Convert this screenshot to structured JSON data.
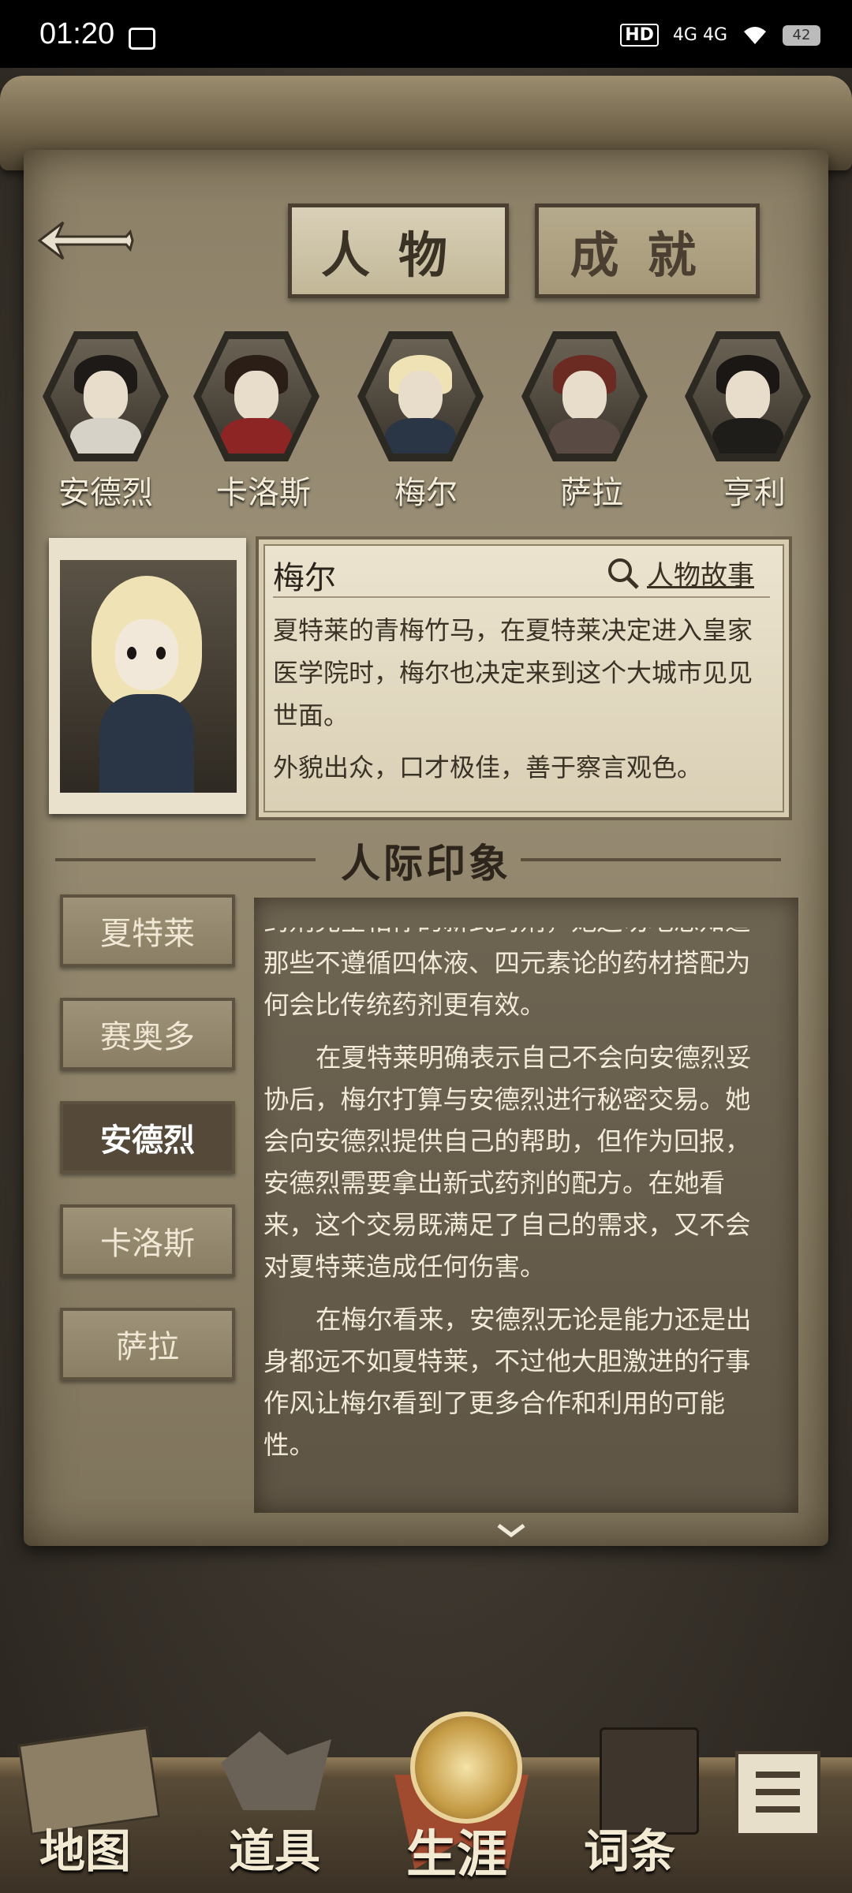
{
  "status_bar": {
    "time": "01:20",
    "network": "4G 4G",
    "hd": "HD",
    "battery": "42"
  },
  "tabs": {
    "characters": "人物",
    "achievements": "成就"
  },
  "characters": [
    {
      "name": "安德烈"
    },
    {
      "name": "卡洛斯"
    },
    {
      "name": "梅尔"
    },
    {
      "name": "萨拉"
    },
    {
      "name": "亨利"
    }
  ],
  "selected": {
    "name": "梅尔",
    "story_link": "人物故事",
    "description": "夏特莱的青梅竹马，在夏特莱决定进入皇家医学院时，梅尔也决定来到这个大城市见见世面。",
    "trait": "外貌出众，口才极佳，善于察言观色。"
  },
  "section_title": "人际印象",
  "relations": [
    {
      "name": "夏特莱"
    },
    {
      "name": "赛奥多"
    },
    {
      "name": "安德烈"
    },
    {
      "name": "卡洛斯"
    },
    {
      "name": "萨拉"
    }
  ],
  "impression": {
    "p1": "药剂完全相悖的新式药剂，她迫切地想知道那些不遵循四体液、四元素论的药材搭配为何会比传统药剂更有效。",
    "p2": "在夏特莱明确表示自己不会向安德烈妥协后，梅尔打算与安德烈进行秘密交易。她会向安德烈提供自己的帮助，但作为回报，安德烈需要拿出新式药剂的配方。在她看来，这个交易既满足了自己的需求，又不会对夏特莱造成任何伤害。",
    "p3": "在梅尔看来，安德烈无论是能力还是出身都远不如夏特莱，不过他大胆激进的行事作风让梅尔看到了更多合作和利用的可能性。"
  },
  "nav": {
    "map": "地图",
    "items": "道具",
    "career": "生涯",
    "glossary": "词条"
  }
}
